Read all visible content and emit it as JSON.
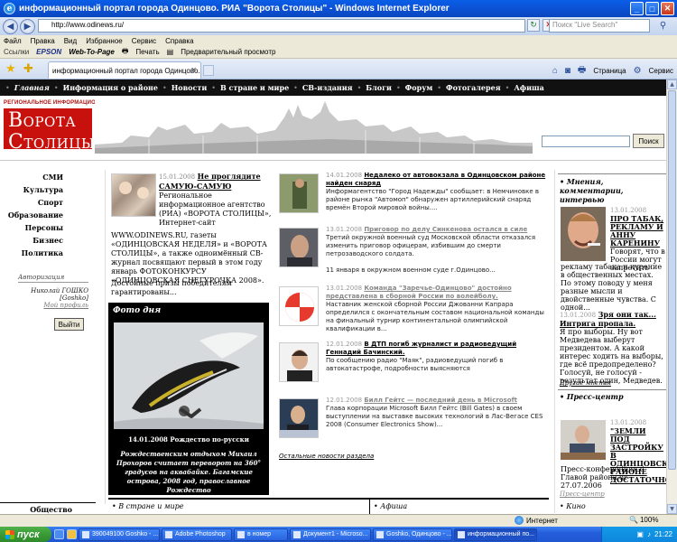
{
  "window": {
    "title": "информационный портал города Одинцово. РИА \"Ворота Столицы\" - Windows Internet Explorer"
  },
  "address": {
    "url": "http://www.odinews.ru/",
    "live_search_placeholder": "Поиск \"Live Search\""
  },
  "menu": [
    "Файл",
    "Правка",
    "Вид",
    "Избранное",
    "Сервис",
    "Справка"
  ],
  "links_bar": {
    "label": "Ссылки",
    "epson": "EPSON",
    "web_to_page": "Web-To-Page",
    "print": "Печать",
    "preview": "Предварительный просмотр"
  },
  "tabs": {
    "active": "информационный портал города Одинцово. РИА \"...",
    "page_menu": "Страница",
    "tools_menu": "Сервис"
  },
  "site_nav": [
    "Главная",
    "Информация о районе",
    "Новости",
    "В стране и мире",
    "СВ-издания",
    "Блоги",
    "Форум",
    "Фотогалерея",
    "Афиша"
  ],
  "header": {
    "agency": "РЕГИОНАЛЬНОЕ ИНФОРМАЦИОННОЕ АГЕНТСТВО",
    "logo_line1_big": "В",
    "logo_line1": "ОРОТА",
    "logo_line2_big": "С",
    "logo_line2": "ТОЛИЦЫ",
    "search_button": "Поиск"
  },
  "left_nav": [
    "СМИ",
    "Культура",
    "Спорт",
    "Образование",
    "Персоны",
    "Бизнес",
    "Политика"
  ],
  "auth": {
    "label": "Авторизация",
    "name": "Николай ГОШКО",
    "nick": "[Goshko]",
    "profile": "Мой профиль",
    "logout": "Выйти"
  },
  "left_bottom": "Общество",
  "feature": {
    "date": "15.01.2008",
    "title": "Не проглядите САМУЮ-САМУЮ",
    "lead": "Региональное информационное агентство (РИА) «ВОРОТА СТОЛИЦЫ», Интернет-сайт",
    "body": "WWW.ODINEWS.RU, газеты «ОДИНЦОВСКАЯ НЕДЕЛЯ» и «ВОРОТА СТОЛИЦЫ», а также одноимённый СВ-журнал посвящают первый в этом году январь ФОТОКОНКУРСУ «ОДИНЦОВСКАЯ СНЕГУРОЧКА 2008».",
    "more": "Достойные призы победителям гарантированы..."
  },
  "photo_day": {
    "title": "Фото дня",
    "caption": "14.01.2008 Рождество по-русски",
    "desc": "Рождественским отдыхом Михаил Прохоров считает переворот на 360° градусов на аквабайке. Багамские острова, 2008 год, православное Рождество"
  },
  "news": [
    {
      "date": "14.01.2008",
      "title": "Недалеко от автовокзала в Одинцовском районе найден снаряд",
      "text": "Информагентство \"Город Надежды\" сообщает: в Немчиновке в районе рынка \"Автомоп\" обнаружен артиллерийский снаряд времён Второй мировой войны....",
      "grey": false
    },
    {
      "date": "13.01.2008",
      "title": "Приговор по делу Синкенова остался в силе",
      "text": "Третий окружной военный суд Московской области отказался изменить приговор офицерам, избившим до смерти петрозаводского солдата.",
      "extra": "11 января в окружном военном суде г.Одинцово...",
      "grey": true
    },
    {
      "date": "13.01.2008",
      "title": "Команда \"Заречье-Одинцово\" достойно представлена в сборной России по волейболу.",
      "text": "Наставник женской сборной России Джованни Капрара определился с окончательным составом национальной команды на финальный турнир континентальной олимпийской квалификации в...",
      "grey": true
    },
    {
      "date": "12.01.2008",
      "title": "В ДТП погиб журналист и радиоведущий Геннадий Бачинский.",
      "text": "По сообщению радио \"Маяк\", радиоведущий погиб в автокатастрофе, подробности выясняются",
      "grey": false
    },
    {
      "date": "12.01.2008",
      "title": "Билл Гейтс — последний день в Microsoft",
      "text": "Глава корпорации Microsoft Билл Гейтс (Bill Gates) в своем выступлении на выставке высоких технологий в Лас-Вегасе CES 2008 (Consumer Electronics Show)...",
      "grey": true
    }
  ],
  "all_news": "Остальные новости раздела",
  "center_bottom": {
    "left": "• В стране и мире",
    "right": "• Афиша"
  },
  "opinions": {
    "heading": "Мнения, комментарии, интервью",
    "date": "13.01.2008",
    "title": "ПРО ТАБАК, РЕКЛАМУ И АННУ КАРЕНИНУ",
    "lead": "Говорят, что в России могут запретить",
    "body": "рекламу табака и курение в общественных местах. По этому поводу у меня разные мысли и двойственные чувства. С одной...",
    "second_date": "13.01.2008",
    "second_title": "Зря они так... Интрига пропала.",
    "second_body": "Я про выборы. Ну вот Медведева выберут президентом. А какой интерес ходить на выборы, где всё предопределено? Голосуй, не голосуй - результат один, Медведев.",
    "all": "Другие мнения"
  },
  "press": {
    "heading": "Пресс-центр",
    "date": "13.01.2008",
    "title": "\"ЗЕМЛИ ПОД ЗАСТРОЙКУ В ОДИНЦОВСКОМ РАЙОНЕ ДОСТАТОЧНО\"",
    "body": "Пресс-конференция с Главой района от 27.07.2006",
    "more": "Пресс-центр"
  },
  "right_bottom": "• Кино",
  "status": {
    "zone": "Интернет",
    "zoom": "100%"
  },
  "taskbar": {
    "start": "пуск",
    "tasks": [
      "390049100 Goshko - ...",
      "Adobe Photoshop",
      "в номер",
      "Документ1 - Microso...",
      "Goshko, Одинцово - ...",
      "информационный по..."
    ],
    "lang": "EN",
    "clock": "21:22"
  },
  "colors": {
    "logo_red": "#c8100c",
    "nav_black": "#111111",
    "xp_blue": "#245edb",
    "start_green": "#3a9a36"
  }
}
